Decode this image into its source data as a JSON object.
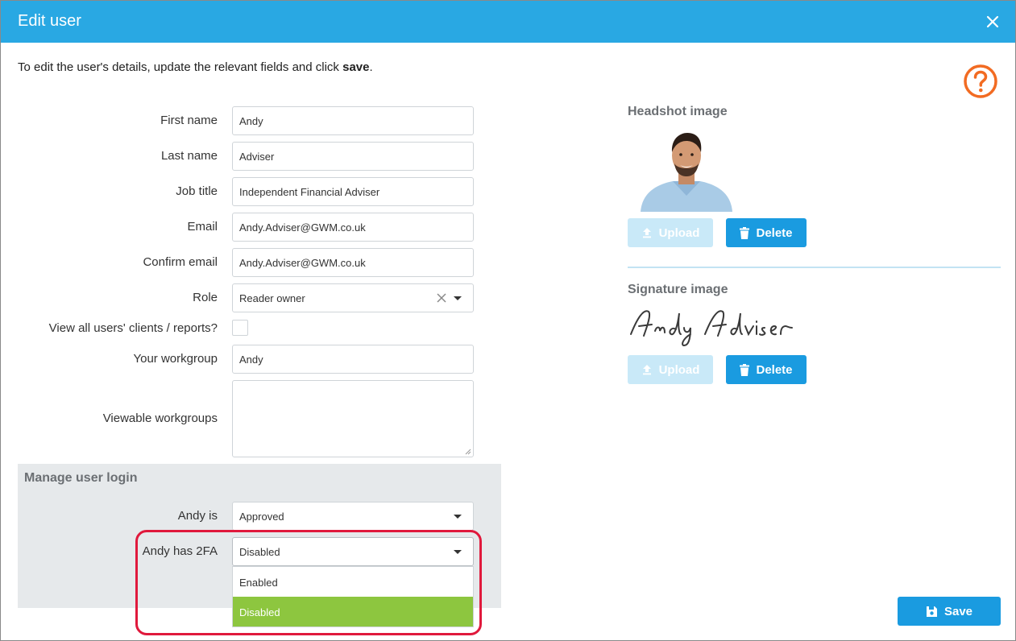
{
  "dialog": {
    "title": "Edit user",
    "intro_text": "To edit the user's details, update the relevant fields and click ",
    "intro_bold": "save",
    "intro_end": "."
  },
  "form": {
    "first_name_label": "First name",
    "first_name_value": "Andy",
    "last_name_label": "Last name",
    "last_name_value": "Adviser",
    "job_title_label": "Job title",
    "job_title_value": "Independent Financial Adviser",
    "email_label": "Email",
    "email_value": "Andy.Adviser@GWM.co.uk",
    "confirm_email_label": "Confirm email",
    "confirm_email_value": "Andy.Adviser@GWM.co.uk",
    "role_label": "Role",
    "role_value": "Reader owner",
    "view_all_label": "View all users' clients / reports?",
    "workgroup_label": "Your workgroup",
    "workgroup_value": "Andy",
    "viewable_label": "Viewable workgroups"
  },
  "manage_login": {
    "title": "Manage user login",
    "status_label": "Andy is",
    "status_value": "Approved",
    "twofa_label": "Andy has 2FA",
    "twofa_value": "Disabled",
    "twofa_options": [
      "Enabled",
      "Disabled"
    ]
  },
  "headshot": {
    "title": "Headshot image",
    "upload_label": "Upload",
    "delete_label": "Delete"
  },
  "signature": {
    "title": "Signature image",
    "upload_label": "Upload",
    "delete_label": "Delete"
  },
  "footer": {
    "save_label": "Save"
  },
  "colors": {
    "titlebar": "#29a8e3",
    "primary_button": "#1a9be0",
    "disabled_button": "#c9e9f8",
    "selected_option": "#8dc63f",
    "highlight": "#e0193c",
    "help_icon": "#f26b22"
  }
}
